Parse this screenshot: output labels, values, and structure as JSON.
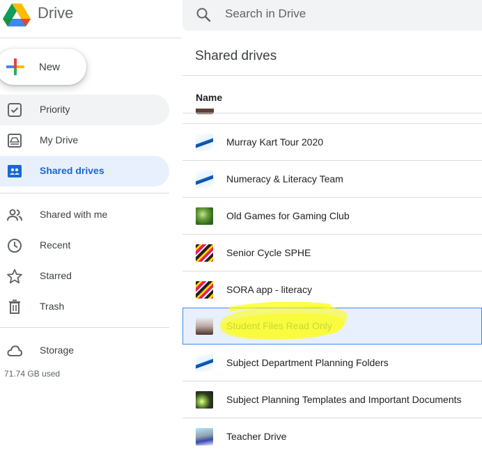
{
  "app": {
    "name": "Drive"
  },
  "search": {
    "placeholder": "Search in Drive"
  },
  "new_button": {
    "label": "New"
  },
  "sidebar": {
    "items": [
      {
        "label": "Priority",
        "icon": "priority-icon"
      },
      {
        "label": "My Drive",
        "icon": "my-drive-icon"
      },
      {
        "label": "Shared drives",
        "icon": "shared-drives-icon",
        "active": true
      },
      {
        "label": "Shared with me",
        "icon": "people-icon"
      },
      {
        "label": "Recent",
        "icon": "clock-icon"
      },
      {
        "label": "Starred",
        "icon": "star-icon"
      },
      {
        "label": "Trash",
        "icon": "trash-icon"
      },
      {
        "label": "Storage",
        "icon": "cloud-icon"
      }
    ],
    "storage_used": "71.74 GB used"
  },
  "main": {
    "title": "Shared drives",
    "column_header": "Name",
    "rows": [
      {
        "name": "Murray Kart Tour 2020",
        "thumb": "mountain"
      },
      {
        "name": "Numeracy & Literacy Team",
        "thumb": "mountain"
      },
      {
        "name": "Old Games for Gaming Club",
        "thumb": "green"
      },
      {
        "name": "Senior Cycle SPHE",
        "thumb": "stripes"
      },
      {
        "name": "SORA app - literacy",
        "thumb": "stripes"
      },
      {
        "name": "Student Files Read Only",
        "thumb": "crowd",
        "selected": true
      },
      {
        "name": "Subject Department Planning Folders",
        "thumb": "mountain"
      },
      {
        "name": "Subject Planning Templates and Important Documents",
        "thumb": "flower"
      },
      {
        "name": "Teacher Drive",
        "thumb": "teacher"
      }
    ]
  },
  "colors": {
    "accent": "#1967d2",
    "active_bg": "#e8f0fe",
    "highlight": "#ffff00"
  }
}
